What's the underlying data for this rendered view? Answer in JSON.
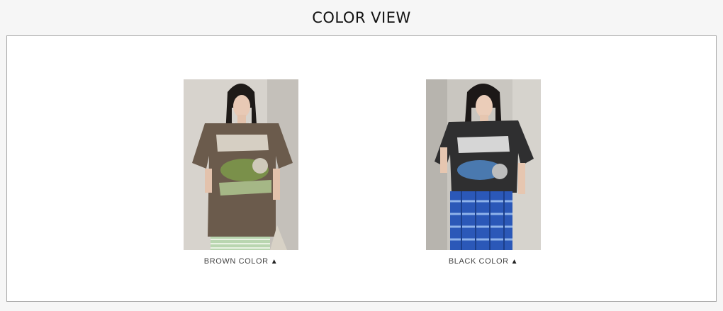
{
  "header": {
    "title": "COLOR VIEW"
  },
  "colors": [
    {
      "label": "BROWN COLOR",
      "arrow": "▲",
      "shirt": "#6b5b4c",
      "bottom": "#b9d6b0",
      "backdrop": "#d7d3cd"
    },
    {
      "label": "BLACK COLOR",
      "arrow": "▲",
      "shirt": "#2f2f30",
      "bottom": "#2b58b8",
      "backdrop": "#c9c6c0"
    }
  ]
}
